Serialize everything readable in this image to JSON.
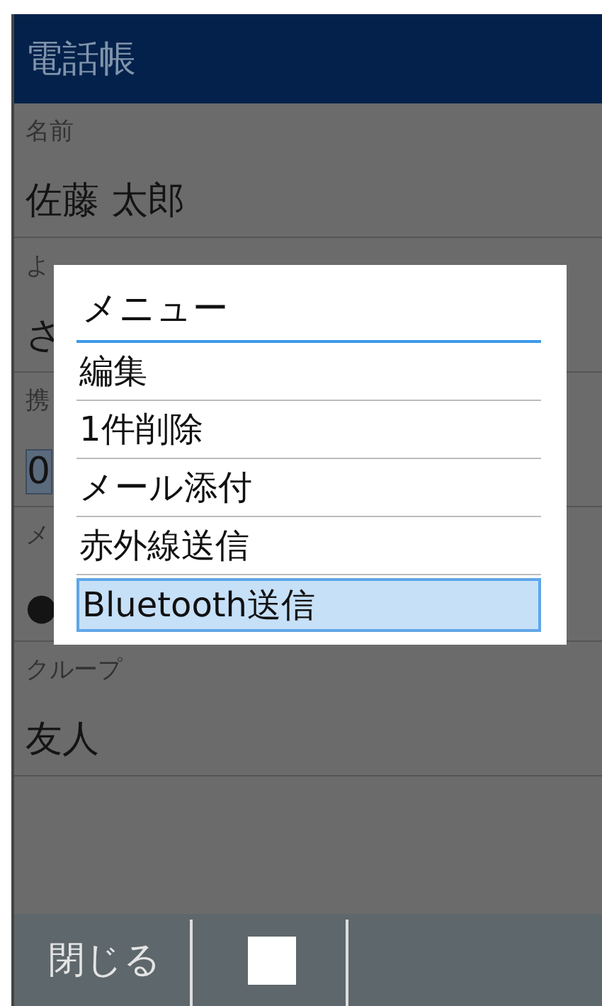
{
  "header": {
    "title": "電話帳"
  },
  "fields": [
    {
      "label": "名前",
      "value": "佐藤 太郎",
      "selected": false
    },
    {
      "label": "よ",
      "value": "さ",
      "selected": false
    },
    {
      "label": "携",
      "value": "0",
      "selected": true
    },
    {
      "label": "メ",
      "value": "●",
      "selected": false
    },
    {
      "label": "クループ",
      "value": "友人",
      "selected": false
    }
  ],
  "menu": {
    "title": "メニュー",
    "items": [
      {
        "label": "編集",
        "selected": false
      },
      {
        "label": "1件削除",
        "selected": false
      },
      {
        "label": "メール添付",
        "selected": false
      },
      {
        "label": "赤外線送信",
        "selected": false
      },
      {
        "label": "Bluetooth送信",
        "selected": true
      }
    ]
  },
  "footer": {
    "buttons": [
      {
        "kind": "text",
        "label": "閉じる"
      },
      {
        "kind": "square"
      }
    ]
  }
}
